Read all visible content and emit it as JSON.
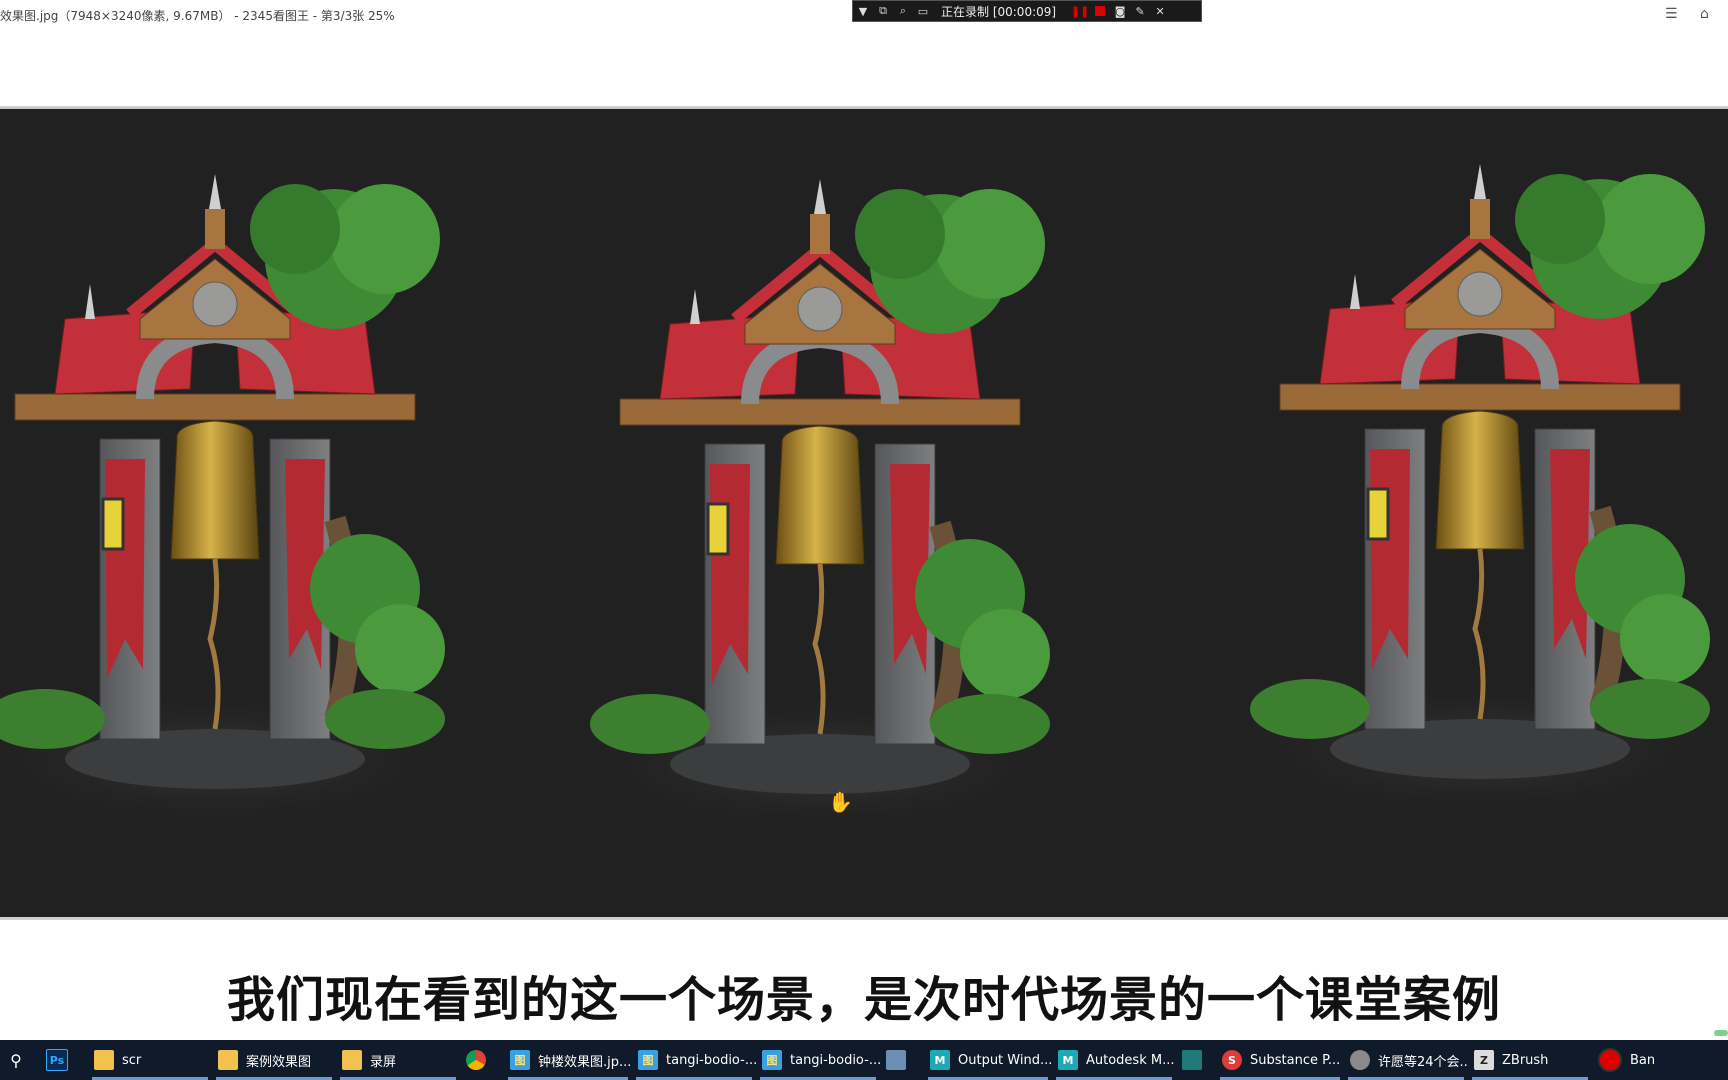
{
  "window": {
    "title": "效果图.jpg（7948×3240像素, 9.67MB） - 2345看图王 - 第3/3张 25%"
  },
  "recorder": {
    "status": "正在录制 [00:00:09]"
  },
  "subtitle": "我们现在看到的这一个场景，是次时代场景的一个课堂案例",
  "taskbar": {
    "items": [
      {
        "label": "",
        "icon": "search-icon"
      },
      {
        "label": "",
        "icon": "photoshop-icon"
      },
      {
        "label": "scr",
        "icon": "folder-icon"
      },
      {
        "label": "案例效果图",
        "icon": "folder-icon"
      },
      {
        "label": "录屏",
        "icon": "folder-icon"
      },
      {
        "label": "",
        "icon": "chrome-icon"
      },
      {
        "label": "钟楼效果图.jp...",
        "icon": "image-viewer-icon"
      },
      {
        "label": "tangi-bodio-...",
        "icon": "image-viewer-icon"
      },
      {
        "label": "tangi-bodio-...",
        "icon": "image-viewer-icon"
      },
      {
        "label": "",
        "icon": "window-icon"
      },
      {
        "label": "Output Wind...",
        "icon": "maya-icon"
      },
      {
        "label": "Autodesk M...",
        "icon": "maya-icon"
      },
      {
        "label": "",
        "icon": "app-icon"
      },
      {
        "label": "Substance P...",
        "icon": "substance-icon"
      },
      {
        "label": "许愿等24个会...",
        "icon": "chat-icon"
      },
      {
        "label": "ZBrush",
        "icon": "zbrush-icon"
      },
      {
        "label": "Bandic",
        "icon": "bandicam-icon"
      }
    ]
  },
  "colors": {
    "panel_bg": "#212121",
    "taskbar_bg": "#0f1a2a",
    "roof_red": "#c3303a",
    "stone_gray": "#6e6e6a",
    "leaf_green": "#3f8a35",
    "bell_gold": "#b08a2a"
  }
}
